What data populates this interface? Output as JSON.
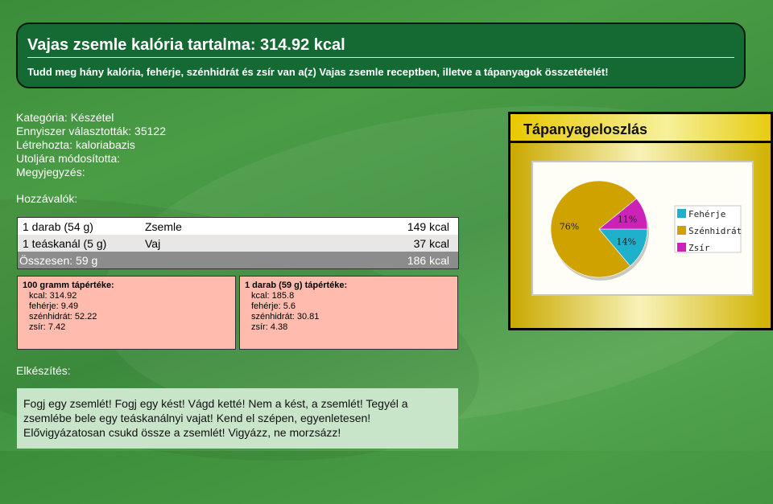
{
  "header": {
    "title": "Vajas zsemle kalória tartalma: 314.92 kcal",
    "subtitle": "Tudd meg hány kalória, fehérje, szénhidrát és zsír van a(z) Vajas zsemle receptben, illetve a tápanyagok összetételét!"
  },
  "meta": {
    "category": "Kategória: Készétel",
    "chosen": "Ennyiszer választották: 35122",
    "created": "Létrehozta: kaloriabazis",
    "modified": "Utoljára módosította:",
    "note": "Megyjegyzés:"
  },
  "ingredients": {
    "label": "Hozzávalók:",
    "rows": [
      {
        "amount": "1 darab (54 g)",
        "name": "Zsemle",
        "kcal": "149 kcal"
      },
      {
        "amount": "1 teáskanál (5 g)",
        "name": "Vaj",
        "kcal": "37 kcal"
      }
    ],
    "total": {
      "label": "Összesen: 59 g",
      "kcal": "186 kcal"
    }
  },
  "per100": {
    "title": "100 gramm tápértéke:",
    "kcal": "kcal: 314.92",
    "protein": "fehérje: 9.49",
    "carbs": "szénhidrát: 52.22",
    "fat": "zsír: 7.42"
  },
  "perPiece": {
    "title": "1 darab (59 g) tápértéke:",
    "kcal": "kcal: 185.8",
    "protein": "fehérje: 5.6",
    "carbs": "szénhidrát: 30.81",
    "fat": "zsír: 4.38"
  },
  "preparation": {
    "label": "Elkészítés:",
    "text": "Fogj egy zsemlét! Fogj egy kést! Vágd ketté! Nem a kést, a zsemlét! Tegyél a zsemlébe bele egy teáskanálnyi vajat! Kend el szépen, egyenletesen! Elővigyázatosan csukd össze a zsemlét! Vigyázz, ne morzsázz!"
  },
  "chart_panel": {
    "title": "Tápanyageloszlás"
  },
  "chart_data": {
    "type": "pie",
    "title": "",
    "categories": [
      "Fehérje",
      "Szénhidrát",
      "Zsír"
    ],
    "values": [
      14,
      76,
      11
    ],
    "labels": [
      "14%",
      "76%",
      "11%"
    ],
    "colors": [
      "#1fb0cc",
      "#d0a200",
      "#cc22b8"
    ],
    "legend": "right"
  }
}
